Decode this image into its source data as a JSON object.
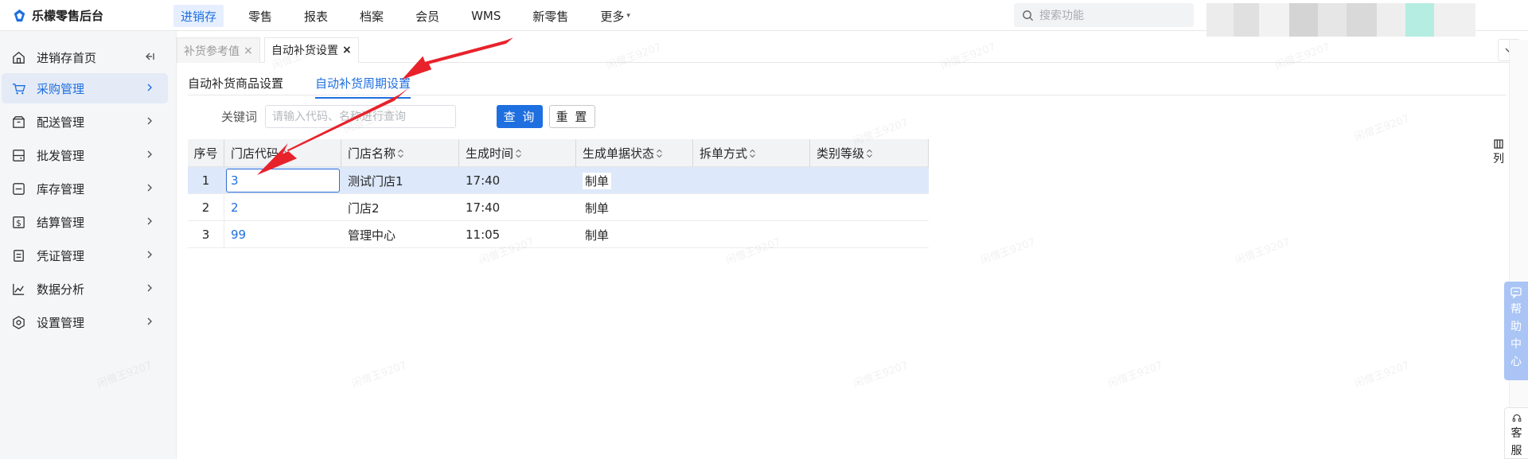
{
  "app": {
    "title": "乐檬零售后台"
  },
  "top_nav": {
    "items": [
      {
        "label": "进销存",
        "active": true
      },
      {
        "label": "零售",
        "active": false
      },
      {
        "label": "报表",
        "active": false
      },
      {
        "label": "档案",
        "active": false
      },
      {
        "label": "会员",
        "active": false
      },
      {
        "label": "WMS",
        "active": false
      },
      {
        "label": "新零售",
        "active": false
      },
      {
        "label": "更多",
        "active": false,
        "caret": "▾"
      }
    ],
    "search_placeholder": "搜索功能"
  },
  "sidebar": {
    "items": [
      {
        "label": "进销存首页",
        "icon": "home-icon",
        "trailing": "collapse-icon"
      },
      {
        "label": "采购管理",
        "icon": "cart-icon",
        "trailing": "chevron-right-icon",
        "active": true
      },
      {
        "label": "配送管理",
        "icon": "delivery-box-icon",
        "trailing": "chevron-right-icon"
      },
      {
        "label": "批发管理",
        "icon": "wholesale-icon",
        "trailing": "chevron-right-icon"
      },
      {
        "label": "库存管理",
        "icon": "inventory-icon",
        "trailing": "chevron-right-icon"
      },
      {
        "label": "结算管理",
        "icon": "dollar-icon",
        "trailing": "chevron-right-icon"
      },
      {
        "label": "凭证管理",
        "icon": "voucher-icon",
        "trailing": "chevron-right-icon"
      },
      {
        "label": "数据分析",
        "icon": "chart-line-icon",
        "trailing": "chevron-right-icon"
      },
      {
        "label": "设置管理",
        "icon": "settings-icon",
        "trailing": "chevron-right-icon"
      }
    ]
  },
  "page_tabs": [
    {
      "label": "补货参考值",
      "close": "×",
      "active": false
    },
    {
      "label": "自动补货设置",
      "close": "×",
      "active": true
    }
  ],
  "sub_tabs": [
    {
      "label": "自动补货商品设置",
      "active": false
    },
    {
      "label": "自动补货周期设置",
      "active": true
    }
  ],
  "filter": {
    "keyword_label": "关键词",
    "keyword_placeholder": "请输入代码、名称进行查询",
    "query_button": "查 询",
    "reset_button": "重 置"
  },
  "table": {
    "columns": [
      "序号",
      "门店代码",
      "门店名称",
      "生成时间",
      "生成单据状态",
      "拆单方式",
      "类别等级"
    ],
    "rows": [
      {
        "index": "1",
        "store_code": "3",
        "store_name": "测试门店1",
        "time": "17:40",
        "status": "制单",
        "split": "",
        "category_level": "",
        "selected": true
      },
      {
        "index": "2",
        "store_code": "2",
        "store_name": "门店2",
        "time": "17:40",
        "status": "制单",
        "split": "",
        "category_level": ""
      },
      {
        "index": "3",
        "store_code": "99",
        "store_name": "管理中心",
        "time": "11:05",
        "status": "制单",
        "split": "",
        "category_level": ""
      }
    ]
  },
  "right_panel": {
    "column_setting_label": "列",
    "help_center": [
      "帮",
      "助",
      "中",
      "心"
    ],
    "customer_service": [
      "客",
      "服"
    ]
  },
  "watermark_text": "闲僧王9207",
  "colors": {
    "accent": "#1e6fe0",
    "selected_row": "#dde8fa",
    "annotation_arrow": "#e8222b"
  }
}
